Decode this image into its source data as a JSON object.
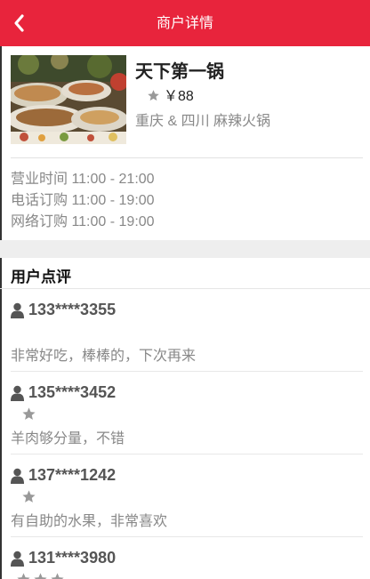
{
  "header": {
    "title": "商户详情",
    "back_icon": "chevron-left-icon",
    "color": "#e8243c"
  },
  "merchant": {
    "name": "天下第一锅",
    "rating_stars": 1,
    "price": "￥88",
    "cuisine": "重庆 & 四川 麻辣火锅",
    "photo": "buffet-food-photo"
  },
  "hours": {
    "business": "营业时间 11:00 - 21:00",
    "phone_order": "电话订购 11:00 - 19:00",
    "online_order": "网络订购 11:00 - 19:00"
  },
  "reviews": {
    "heading": "用户点评",
    "items": [
      {
        "user": "133****3355",
        "stars": 0,
        "comment": "非常好吃，棒棒的，下次再来"
      },
      {
        "user": "135****3452",
        "stars": 1,
        "comment": "羊肉够分量，不错"
      },
      {
        "user": "137****1242",
        "stars": 1,
        "comment": "有自助的水果，非常喜欢"
      },
      {
        "user": "131****3980",
        "stars": 3,
        "comment": ""
      }
    ]
  }
}
